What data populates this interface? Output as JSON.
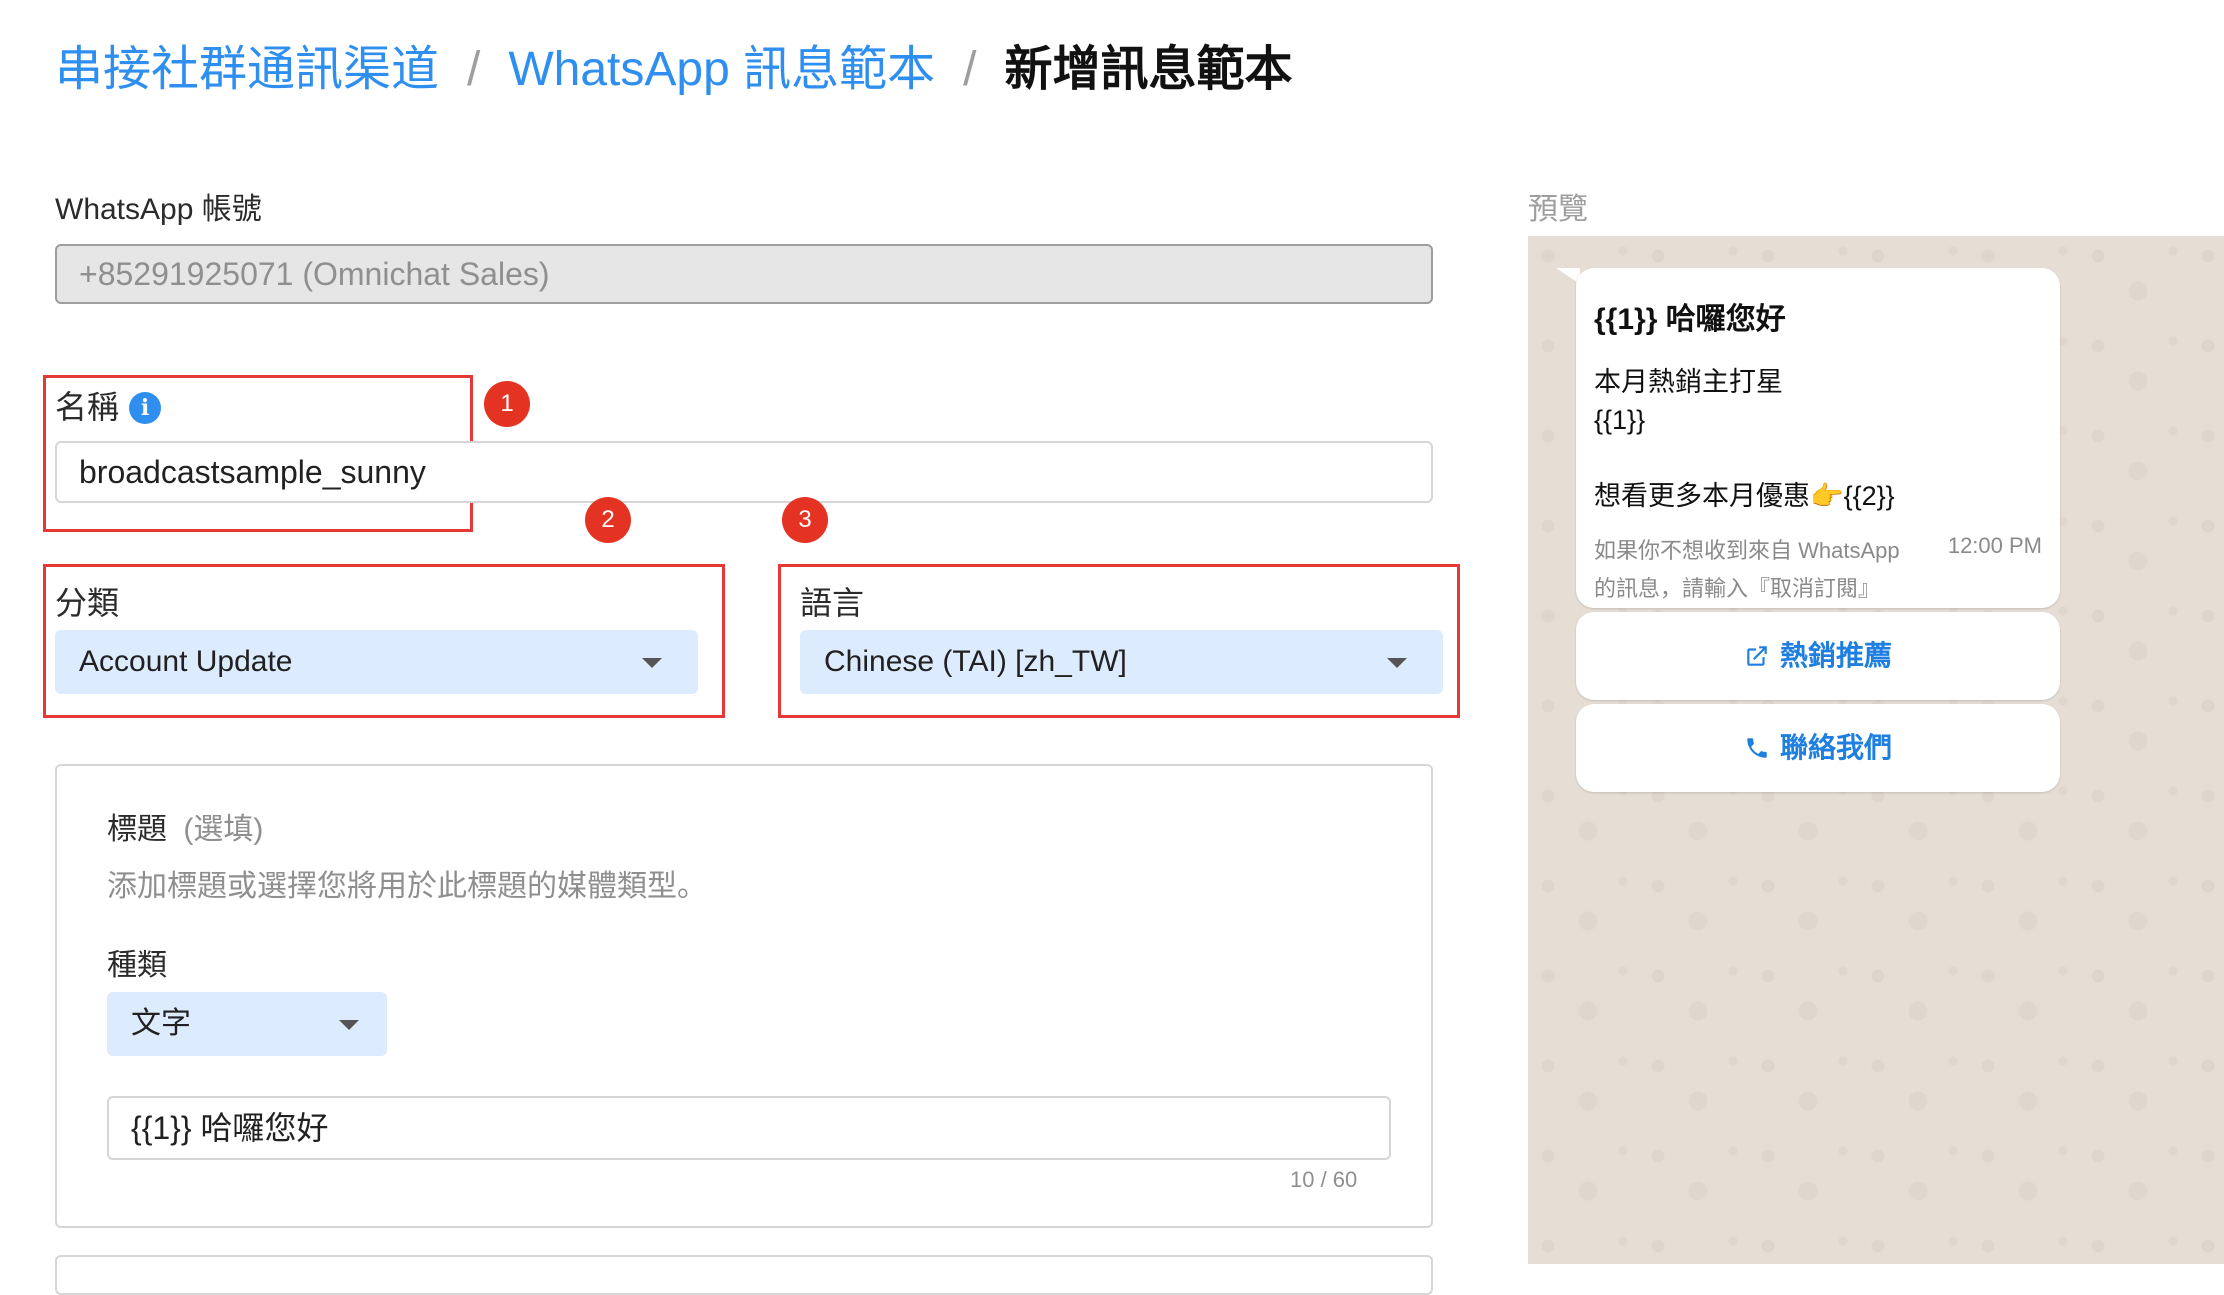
{
  "breadcrumb": {
    "item1": "串接社群通訊渠道",
    "separator": "/",
    "item2": "WhatsApp 訊息範本",
    "current": "新增訊息範本"
  },
  "account": {
    "label": "WhatsApp 帳號",
    "value": "+85291925071 (Omnichat Sales)"
  },
  "name": {
    "label": "名稱",
    "value": "broadcastsample_sunny"
  },
  "category": {
    "label": "分類",
    "selected": "Account Update"
  },
  "language": {
    "label": "語言",
    "selected": "Chinese (TAI) [zh_TW]"
  },
  "badges": [
    "1",
    "2",
    "3"
  ],
  "header_section": {
    "title": "標題",
    "optional": "(選填)",
    "description": "添加標題或選擇您將用於此標題的媒體類型。",
    "type_label": "種類",
    "type_selected": "文字",
    "input_value": "{{1}} 哈囉您好",
    "counter": "10 / 60"
  },
  "preview": {
    "label": "預覽",
    "header": "{{1}} 哈囉您好",
    "body_line1": "本月熱銷主打星",
    "body_line2": "{{1}}",
    "body_line3": "想看更多本月優惠👉{{2}}",
    "footer_line1": "如果你不想收到來自 WhatsApp",
    "footer_line2": "的訊息，請輸入『取消訂閱』",
    "time": "12:00 PM",
    "button1": "熱銷推薦",
    "button2": "聯絡我們"
  },
  "colors": {
    "link": "#2f8ff0",
    "highlight": "#e53935",
    "select_bg": "#dcebfd",
    "preview_bg": "#e6ded5",
    "preview_button": "#1f7fe0"
  }
}
